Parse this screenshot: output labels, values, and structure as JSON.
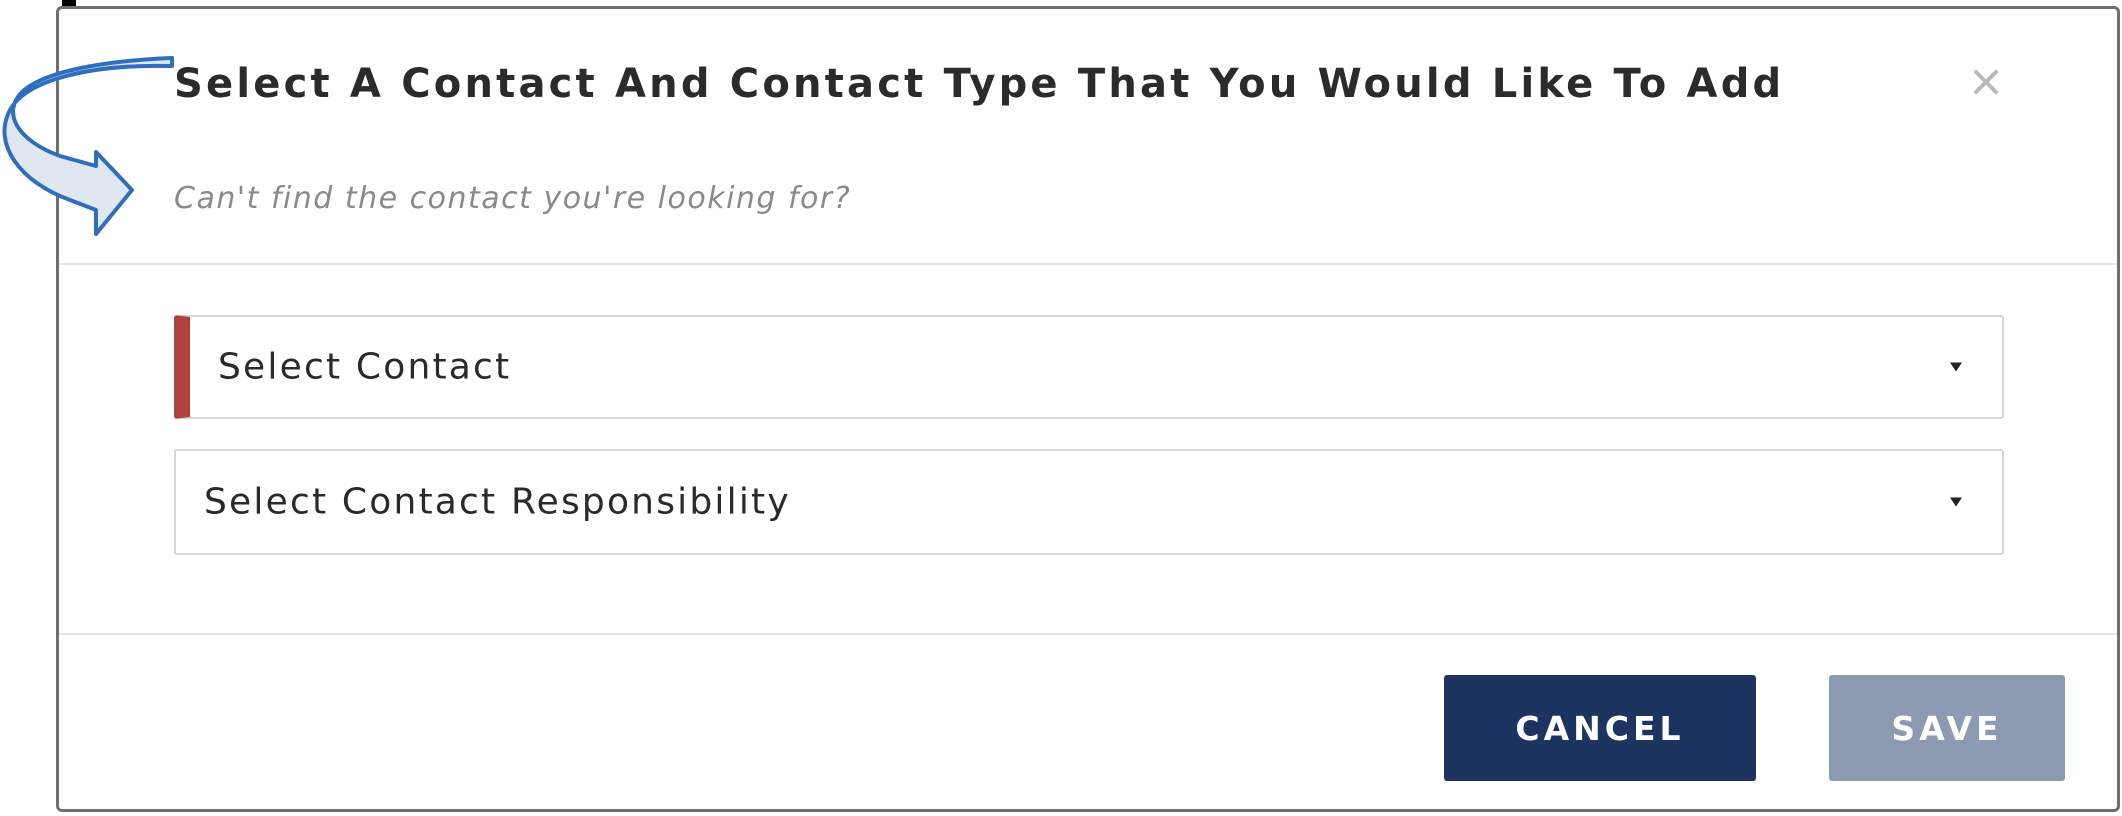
{
  "dialog": {
    "title": "Select A Contact And Contact Type That You Would Like To Add",
    "subtitle": "Can't find the contact you're looking for?",
    "close_symbol": "×",
    "close_icon": "close-icon"
  },
  "form": {
    "contact_select": {
      "selected_text": "Select Contact",
      "state": "required-invalid",
      "accent_color": "#b0413e"
    },
    "responsibility_select": {
      "selected_text": "Select Contact Responsibility"
    }
  },
  "actions": {
    "cancel_label": "CANCEL",
    "save_label": "SAVE",
    "cancel_color": "#1d3461",
    "save_color": "#8d9bb2"
  },
  "annotation": {
    "type": "curved-arrow",
    "icon": "curved-arrow-icon",
    "color": "#2f6ebf",
    "points_to": "subtitle"
  }
}
